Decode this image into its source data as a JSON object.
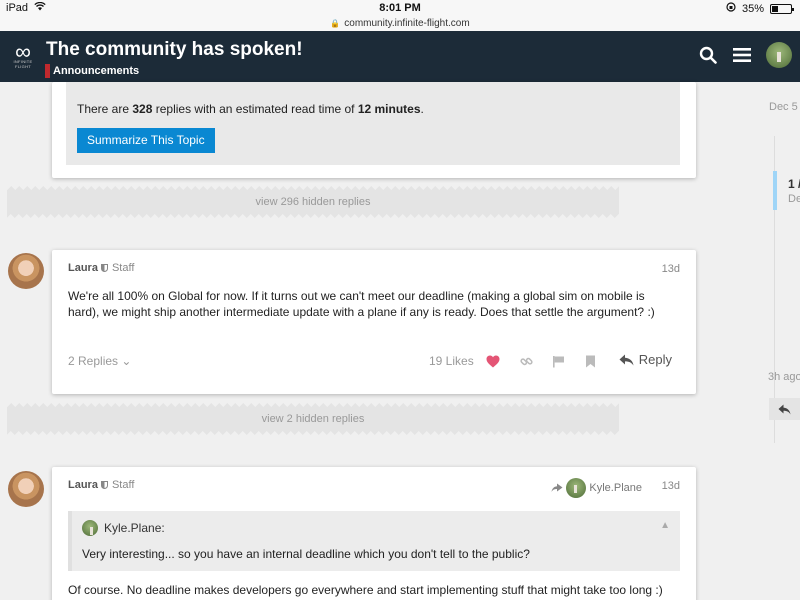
{
  "status_bar": {
    "device": "iPad",
    "time": "8:01 PM",
    "battery": "35%",
    "battery_level": 0.35
  },
  "url_bar": {
    "url": "community.infinite-flight.com"
  },
  "header": {
    "logo_text": "INFINITE FLIGHT",
    "title": "The community has spoken!",
    "category": "Announcements",
    "category_color": "#c0292e"
  },
  "summary": {
    "text_prefix": "There are ",
    "replies": "328",
    "text_middle": " replies with an estimated read time of ",
    "read_time": "12 minutes",
    "text_suffix": ".",
    "button_label": "Summarize This Topic"
  },
  "gaps": [
    {
      "label": "view 296 hidden replies"
    },
    {
      "label": "view 2 hidden replies"
    }
  ],
  "posts": [
    {
      "username": "Laura",
      "user_title": "Staff",
      "date": "13d",
      "body": "We're all 100% on Global for now. If it turns out we can't meet our deadline (making a global sim on mobile is hard), we might ship another intermediate update with a plane if any is ready. Does that settle the argument? :)",
      "replies_label": "2 Replies",
      "likes_label": "19 Likes",
      "reply_label": "Reply"
    },
    {
      "username": "Laura",
      "user_title": "Staff",
      "date": "13d",
      "reply_to": "Kyle.Plane",
      "quote_author": "Kyle.Plane:",
      "quote_text": "Very interesting... so you have an internal deadline which you don't tell to the public?",
      "body": "Of course. No deadline makes developers go everywhere and start implementing stuff that might take too long :)"
    }
  ],
  "timeline": {
    "top_date": "Dec 5",
    "position": "1 /",
    "position_date": "De",
    "bottom_label": "3h ago"
  },
  "colors": {
    "header_bg": "#1c2b38",
    "accent_blue": "#0a88d2",
    "like_heart": "#e45575"
  }
}
